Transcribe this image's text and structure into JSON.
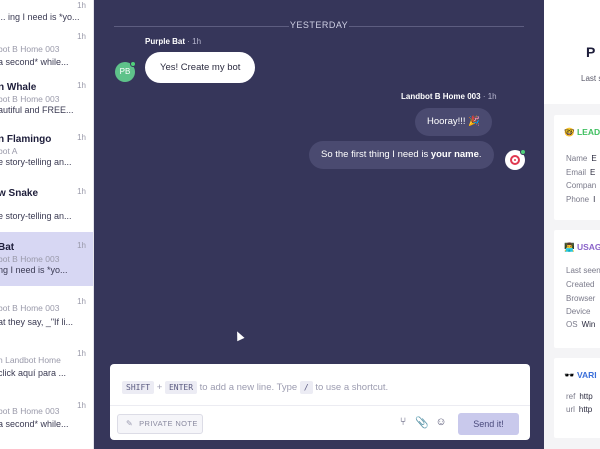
{
  "conversations": [
    {
      "name": "",
      "sub": "",
      "preview": "... ing I need is *yo...",
      "time": "1h",
      "active": false
    },
    {
      "name": "",
      "sub": "bot B Home 003",
      "preview": "a second* while...",
      "time": "1h",
      "active": false
    },
    {
      "name": "n Whale",
      "sub": "bot B Home 003",
      "preview": "autiful and FREE...",
      "time": "1h",
      "active": false
    },
    {
      "name": "n Flamingo",
      "sub": "bot A",
      "preview": "e story-telling an...",
      "time": "1h",
      "active": false
    },
    {
      "name": "w Snake",
      "sub": "",
      "preview": "e story-telling an...",
      "time": "1h",
      "active": false
    },
    {
      "name": "Bat",
      "sub": "bot B Home 003",
      "preview": "ng I need is *yo...",
      "time": "1h",
      "active": true
    },
    {
      "name": "",
      "sub": "bot B Home 003",
      "preview": "at they say, _\"If li...",
      "time": "1h",
      "active": false
    },
    {
      "name": "",
      "sub": "h Landbot Home",
      "preview": "click aquí para ...",
      "time": "1h",
      "active": false
    },
    {
      "name": "",
      "sub": "bot B Home 003",
      "preview": "a second* while...",
      "time": "1h",
      "active": false
    }
  ],
  "chat": {
    "divider_label": "YESTERDAY",
    "sender_in": "Purple Bat",
    "sender_in_time": "· 1h",
    "avatar_initials": "PB",
    "message_in": "Yes! Create my bot",
    "sender_out": "Landbot B Home 003",
    "sender_out_time": "· 1h",
    "message_out_1": "Hooray!!! 🎉",
    "message_out_2_prefix": "So the first thing I need is ",
    "message_out_2_bold": "your name",
    "message_out_2_suffix": "."
  },
  "composer": {
    "key_shift": "SHIFT",
    "plus": "+",
    "key_enter": "ENTER",
    "hint_middle": "to add a new line. Type",
    "key_slash": "/",
    "hint_end": "to use a shortcut.",
    "private_note": "PRIVATE NOTE",
    "send": "Send it!"
  },
  "right_panel": {
    "header_big": "P",
    "header_small": "Last s",
    "sections": [
      {
        "icon": "🤓",
        "title": "LEAD",
        "color": "#3fbf5f",
        "rows": [
          {
            "label": "Name",
            "value": "E"
          },
          {
            "label": "Email",
            "value": "E"
          },
          {
            "label": "Compan",
            "value": ""
          },
          {
            "label": "Phone",
            "value": "I"
          }
        ]
      },
      {
        "icon": "👨‍💻",
        "title": "USAG",
        "color": "#8a63c9",
        "rows": [
          {
            "label": "Last seen",
            "value": ""
          },
          {
            "label": "Created",
            "value": ""
          },
          {
            "label": "Browser",
            "value": ""
          },
          {
            "label": "Device",
            "value": ""
          },
          {
            "label": "OS",
            "value": "Win"
          }
        ]
      },
      {
        "icon": "🕶️",
        "title": "VARI",
        "color": "#3b6fd9",
        "rows": [
          {
            "label": "ref",
            "value": "http"
          },
          {
            "label": "url",
            "value": "http"
          }
        ]
      }
    ]
  }
}
